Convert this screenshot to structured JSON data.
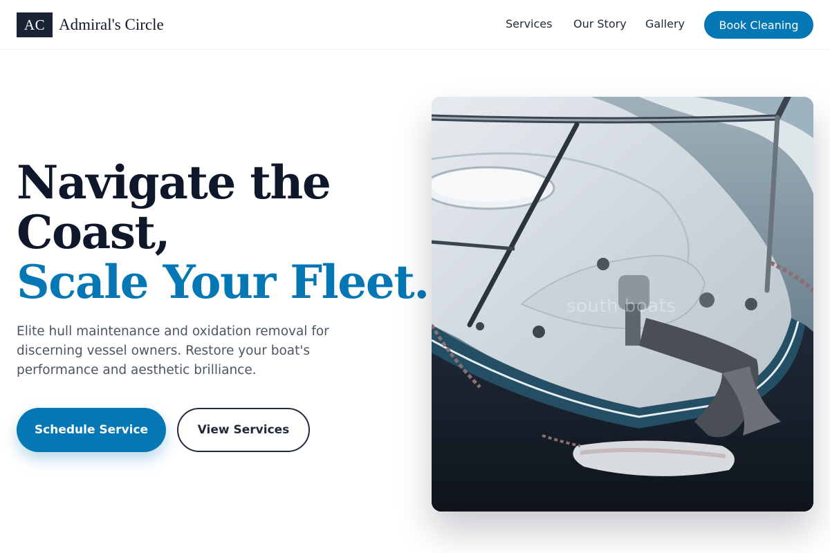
{
  "brand": {
    "logo_text": "AC",
    "name": "Admiral's Circle"
  },
  "nav": {
    "items": [
      {
        "label": "Services"
      },
      {
        "label": "Our Story"
      },
      {
        "label": "Gallery"
      }
    ],
    "cta_label": "Book Cleaning"
  },
  "hero": {
    "headline_line1": "Navigate the",
    "headline_line2": "Coast,",
    "headline_accent": "Scale Your Fleet.",
    "description": "Elite hull maintenance and oxidation removal for discerning vessel owners. Restore your boat's performance and aesthetic brilliance.",
    "primary_cta": "Schedule Service",
    "secondary_cta": "View Services",
    "image": {
      "subject": "boat-bow-photo",
      "watermark_text": "south boats"
    }
  },
  "colors": {
    "accent": "#0477b4",
    "dark": "#0f172a",
    "logo_bg": "#1a2236",
    "body_text": "#4b5563"
  }
}
